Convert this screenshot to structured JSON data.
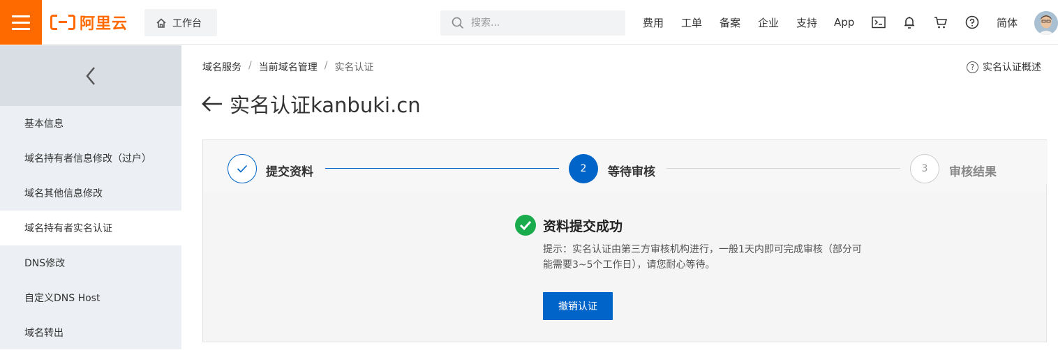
{
  "header": {
    "logo_text": "阿里云",
    "workbench_label": "工作台",
    "search_placeholder": "搜索...",
    "nav": [
      "费用",
      "工单",
      "备案",
      "企业",
      "支持",
      "App"
    ],
    "lang_label": "简体"
  },
  "sidebar": {
    "items": [
      {
        "label": "基本信息"
      },
      {
        "label": "域名持有者信息修改（过户）"
      },
      {
        "label": "域名其他信息修改"
      },
      {
        "label": "域名持有者实名认证"
      },
      {
        "label": "DNS修改"
      },
      {
        "label": "自定义DNS Host"
      },
      {
        "label": "域名转出"
      }
    ],
    "active_index": 3
  },
  "breadcrumb": {
    "items": [
      "域名服务",
      "当前域名管理",
      "实名认证"
    ],
    "separator": "/"
  },
  "overview_link": "实名认证概述",
  "page_title": "实名认证kanbuki.cn",
  "steps": [
    {
      "number": "",
      "label": "提交资料",
      "state": "done"
    },
    {
      "number": "2",
      "label": "等待审核",
      "state": "active"
    },
    {
      "number": "3",
      "label": "审核结果",
      "state": "pending"
    }
  ],
  "result": {
    "title": "资料提交成功",
    "tip_line1": "提示：实名认证由第三方审核机构进行，一般1天内即可完成审核（部分可",
    "tip_line2": "能需要3~5个工作日），请您耐心等待。",
    "button_label": "撤销认证"
  },
  "colors": {
    "brand": "#ff6a00",
    "primary": "#0064c8",
    "success": "#1aab4c"
  }
}
